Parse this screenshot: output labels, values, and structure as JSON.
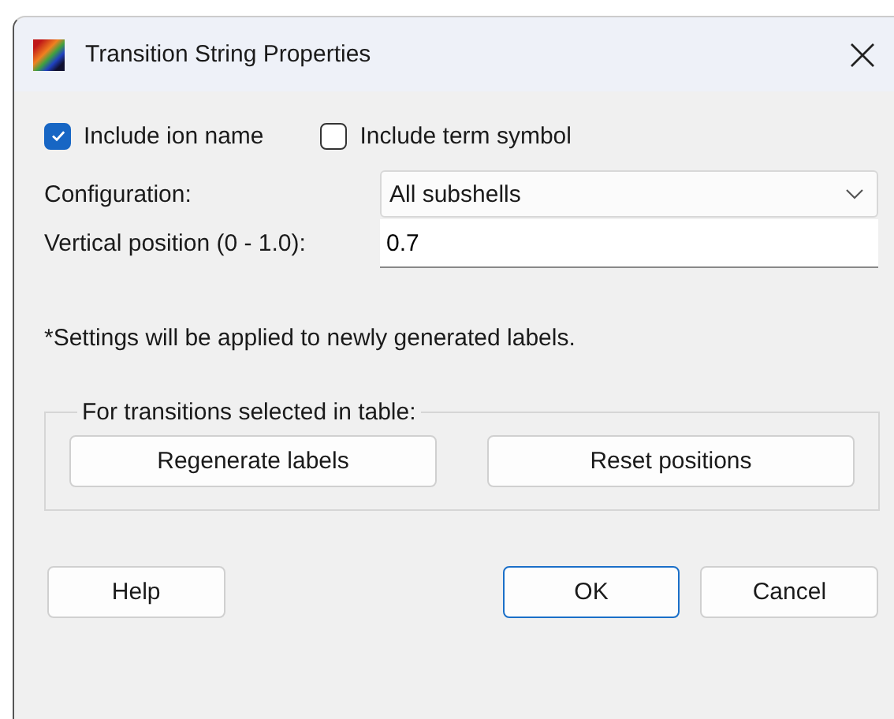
{
  "window": {
    "title": "Transition String Properties"
  },
  "checkboxes": [
    {
      "label": "Include ion name",
      "checked": true
    },
    {
      "label": "Include term symbol",
      "checked": false
    }
  ],
  "configuration": {
    "label": "Configuration:",
    "value": "All subshells"
  },
  "vertical_position": {
    "label": "Vertical position (0 - 1.0):",
    "value": "0.7"
  },
  "note": "*Settings will be applied to newly generated labels.",
  "selection_group": {
    "title": "For transitions selected in table:",
    "buttons": [
      "Regenerate labels",
      "Reset positions"
    ]
  },
  "buttons": [
    {
      "label": "Help",
      "default": false
    },
    {
      "label": "OK",
      "default": true
    },
    {
      "label": "Cancel",
      "default": false
    }
  ]
}
